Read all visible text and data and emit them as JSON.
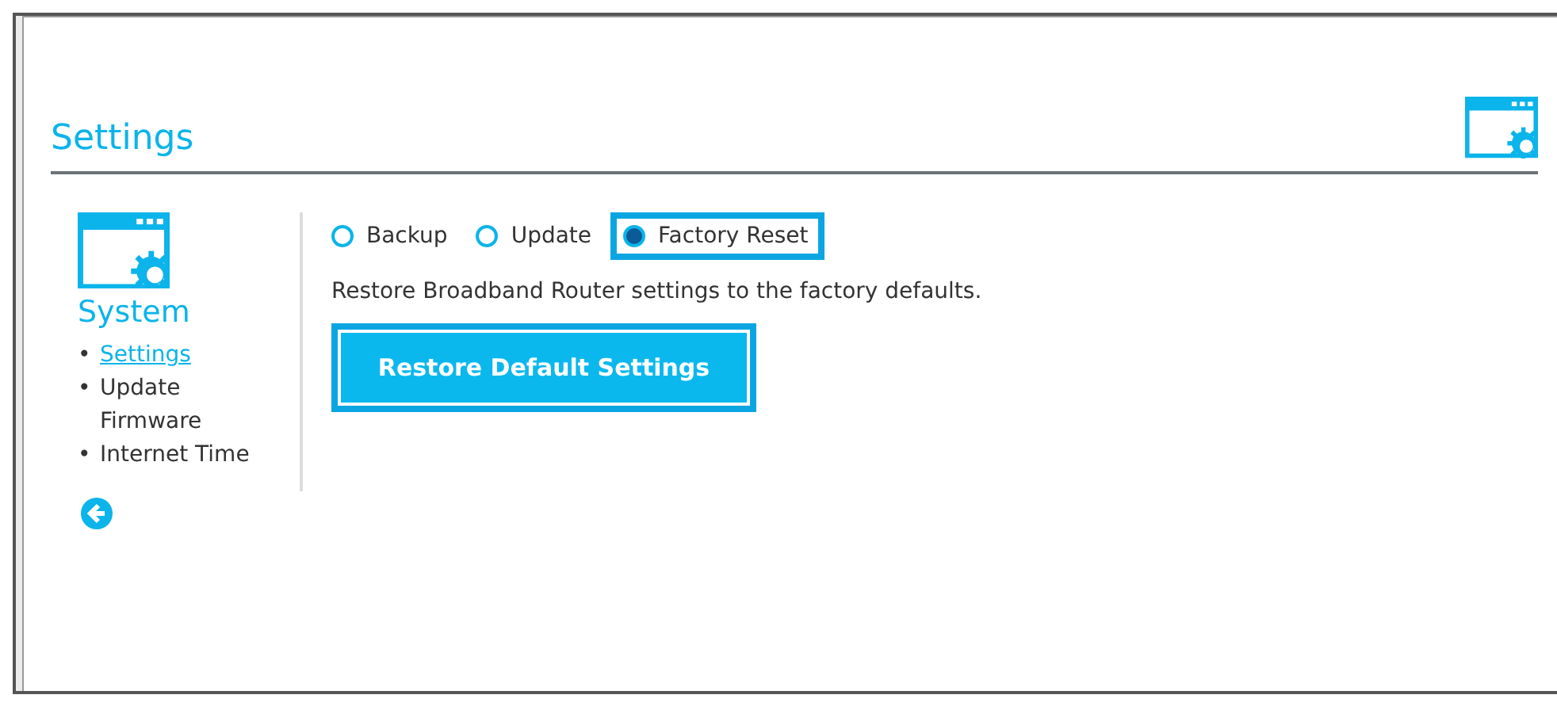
{
  "title": "Settings",
  "sidebar": {
    "heading": "System",
    "items": [
      {
        "bullet": "•",
        "label": "Settings",
        "selected": true
      },
      {
        "bullet": "•",
        "label": "Update Firmware",
        "selected": false
      },
      {
        "bullet": "•",
        "label": "Internet Time",
        "selected": false
      }
    ]
  },
  "options": [
    {
      "label": "Backup",
      "selected": false
    },
    {
      "label": "Update",
      "selected": false
    },
    {
      "label": "Factory Reset",
      "selected": true
    }
  ],
  "description": "Restore Broadband Router settings to the factory defaults.",
  "button": "Restore Default Settings"
}
